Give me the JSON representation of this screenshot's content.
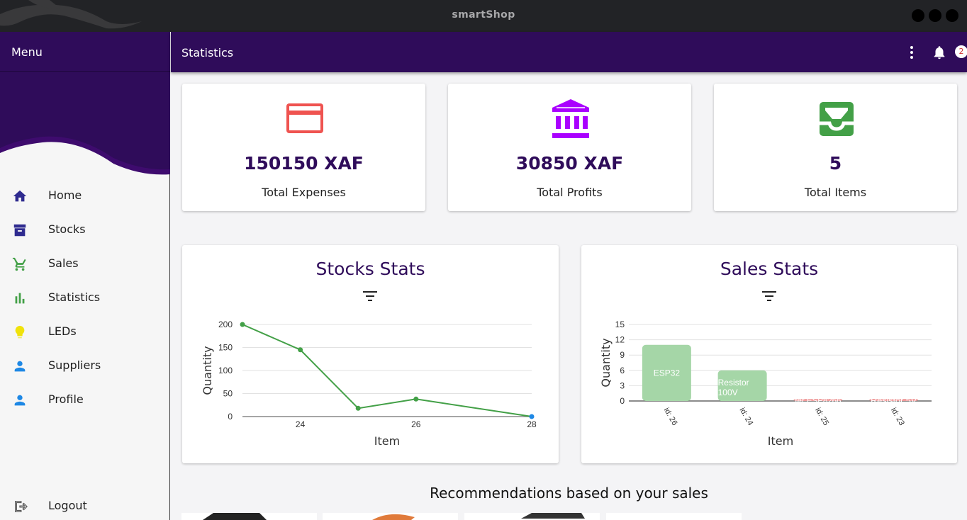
{
  "window": {
    "title": "smartShop"
  },
  "sidebar": {
    "title": "Menu",
    "items": [
      {
        "label": "Home",
        "icon": "home-icon",
        "color": "#2f2b8f"
      },
      {
        "label": "Stocks",
        "icon": "archive-icon",
        "color": "#2f2b8f"
      },
      {
        "label": "Sales",
        "icon": "cart-icon",
        "color": "#43a047"
      },
      {
        "label": "Statistics",
        "icon": "bar-chart-icon",
        "color": "#43a047"
      },
      {
        "label": "LEDs",
        "icon": "lightbulb-icon",
        "color": "#f0e20a"
      },
      {
        "label": "Suppliers",
        "icon": "person-icon",
        "color": "#1e88e5"
      },
      {
        "label": "Profile",
        "icon": "person-icon",
        "color": "#1e88e5"
      }
    ],
    "logout": {
      "label": "Logout",
      "icon": "logout-icon"
    }
  },
  "appbar": {
    "title": "Statistics",
    "notification_count": "2"
  },
  "stats": [
    {
      "value": "150150 XAF",
      "caption": "Total Expenses",
      "icon": "credit-card-icon",
      "color": "#ef5350"
    },
    {
      "value": "30850 XAF",
      "caption": "Total Profits",
      "icon": "bank-icon",
      "color": "#aa00ff"
    },
    {
      "value": "5",
      "caption": "Total Items",
      "icon": "inbox-icon",
      "color": "#43a047"
    }
  ],
  "charts": {
    "stocks": {
      "title": "Stocks Stats"
    },
    "sales": {
      "title": "Sales Stats"
    }
  },
  "chart_data": [
    {
      "type": "line",
      "title": "Stocks Stats",
      "xlabel": "Item",
      "ylabel": "Quantity",
      "x": [
        23,
        24,
        25,
        26,
        28
      ],
      "y": [
        200,
        145,
        18,
        38,
        0
      ],
      "xticks": [
        24,
        26,
        28
      ],
      "yticks": [
        0,
        50,
        100,
        150,
        200
      ],
      "xlim": [
        23,
        28
      ],
      "ylim": [
        0,
        200
      ],
      "grid": true,
      "color": "#43a047"
    },
    {
      "type": "bar",
      "title": "Sales Stats",
      "xlabel": "Item",
      "ylabel": "Quantity",
      "categories": [
        "id: 26",
        "id: 24",
        "id: 25",
        "id: 23"
      ],
      "values": [
        11,
        6,
        0.4,
        0.4
      ],
      "bar_labels": [
        "ESP32",
        "Resistor 100V",
        "ter ESP8266",
        "Resistor 5V"
      ],
      "bar_colors": [
        "#a5d6a7",
        "#a5d6a7",
        "#ef9a9a",
        "#ef9a9a"
      ],
      "yticks": [
        0,
        3,
        6,
        9,
        12,
        15
      ],
      "ylim": [
        0,
        15
      ],
      "grid": true
    }
  ],
  "recommendations": {
    "title": "Recommendations based on your sales"
  }
}
